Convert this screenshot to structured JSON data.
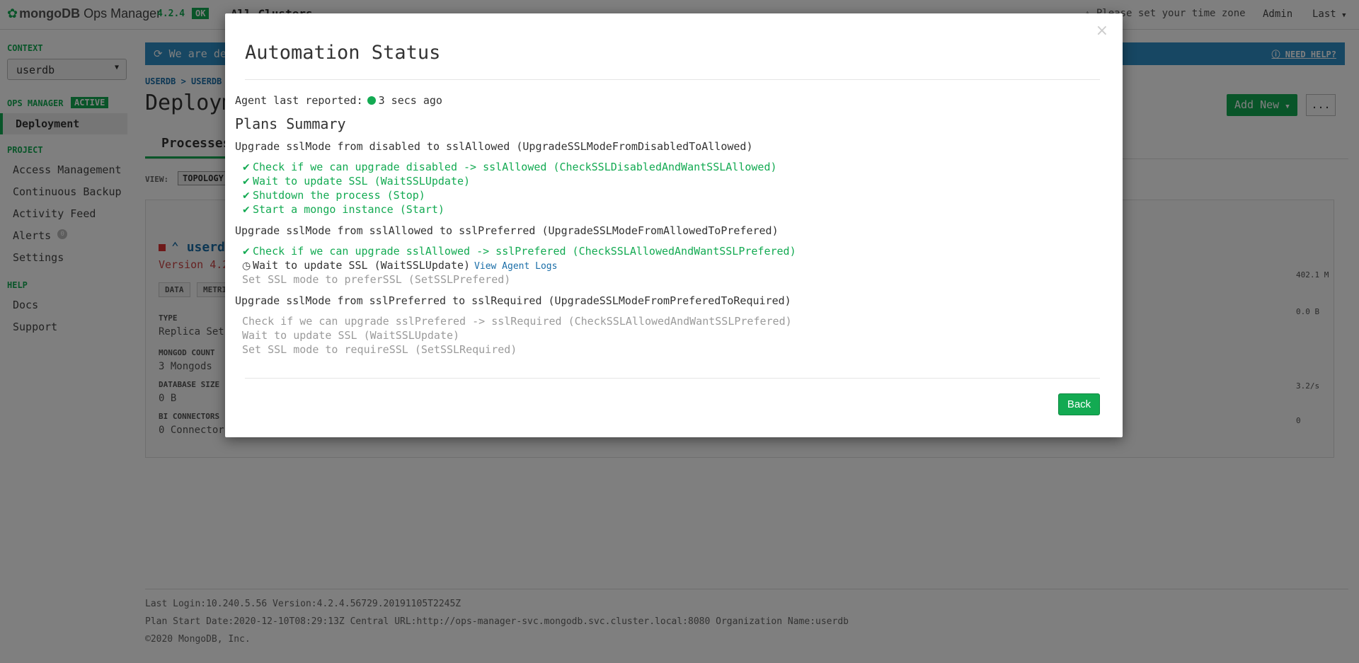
{
  "topbar": {
    "logo_brand": "mongoDB",
    "logo_product": "Ops Manager",
    "version": "4.2.4",
    "status": "OK",
    "clusters": "All Clusters",
    "timezone_warning": "Please set your time zone",
    "user": "Admin",
    "last_menu": "Last"
  },
  "sidebar": {
    "context_heading": "CONTEXT",
    "context_value": "userdb",
    "ops_heading": "OPS MANAGER",
    "ops_badge": "ACTIVE",
    "deployment": "Deployment",
    "project_heading": "PROJECT",
    "project_items": [
      "Access Management",
      "Continuous Backup",
      "Activity Feed",
      "Alerts",
      "Settings"
    ],
    "alerts_count": "0",
    "help_heading": "HELP",
    "help_items": [
      "Docs",
      "Support"
    ]
  },
  "main": {
    "banner": "We are dep",
    "need_help": "NEED HELP?",
    "breadcrumb": "USERDB > USERDB",
    "title": "Deploym",
    "add_new": "Add New",
    "more": "...",
    "tab": "Processes",
    "view_label": "VIEW:",
    "view_button": "TOPOLOGY",
    "card": {
      "name": "userdb",
      "version": "Version 4.2",
      "tag_data": "DATA",
      "tag_metrics": "METRI",
      "type_label": "TYPE",
      "type_value": "Replica Set",
      "count_label": "MONGOD COUNT",
      "count_value": "3 Mongods",
      "size_label": "DATABASE SIZE",
      "size_value": "0 B",
      "bi_label": "BI CONNECTORS",
      "bi_value": "0 Connector",
      "metric_a": "402.1 M",
      "metric_b": "0.0 B",
      "metric_c": "3.2/s",
      "metric_d": "0"
    }
  },
  "footer": {
    "line1": "Last Login:10.240.5.56  Version:4.2.4.56729.20191105T2245Z",
    "line2": "Plan Start Date:2020-12-10T08:29:13Z  Central URL:http://ops-manager-svc.mongodb.svc.cluster.local:8080  Organization Name:userdb",
    "line3": "©2020 MongoDB, Inc."
  },
  "modal": {
    "title": "Automation Status",
    "close": "×",
    "agent_label": "Agent last reported:",
    "agent_value": "3 secs ago",
    "plans_title": "Plans Summary",
    "plan1": "Upgrade sslMode from disabled to sslAllowed (UpgradeSSLModeFromDisabledToAllowed)",
    "plan1_steps": [
      "Check if we can upgrade disabled -> sslAllowed (CheckSSLDisabledAndWantSSLAllowed)",
      "Wait to update SSL (WaitSSLUpdate)",
      "Shutdown the process (Stop)",
      "Start a mongo instance (Start)"
    ],
    "plan2": "Upgrade sslMode from sslAllowed to sslPreferred (UpgradeSSLModeFromAllowedToPrefered)",
    "plan2_steps": [
      "Check if we can upgrade sslAllowed -> sslPrefered (CheckSSLAllowedAndWantSSLPrefered)",
      "Wait to update SSL (WaitSSLUpdate)",
      "Set SSL mode to preferSSL (SetSSLPrefered)"
    ],
    "view_logs": "View Agent Logs",
    "plan3": "Upgrade sslMode from sslPreferred to sslRequired (UpgradeSSLModeFromPreferedToRequired)",
    "plan3_steps": [
      "Check if we can upgrade sslPrefered -> sslRequired (CheckSSLAllowedAndWantSSLPrefered)",
      "Wait to update SSL (WaitSSLUpdate)",
      "Set SSL mode to requireSSL (SetSSLRequired)"
    ],
    "back": "Back"
  }
}
